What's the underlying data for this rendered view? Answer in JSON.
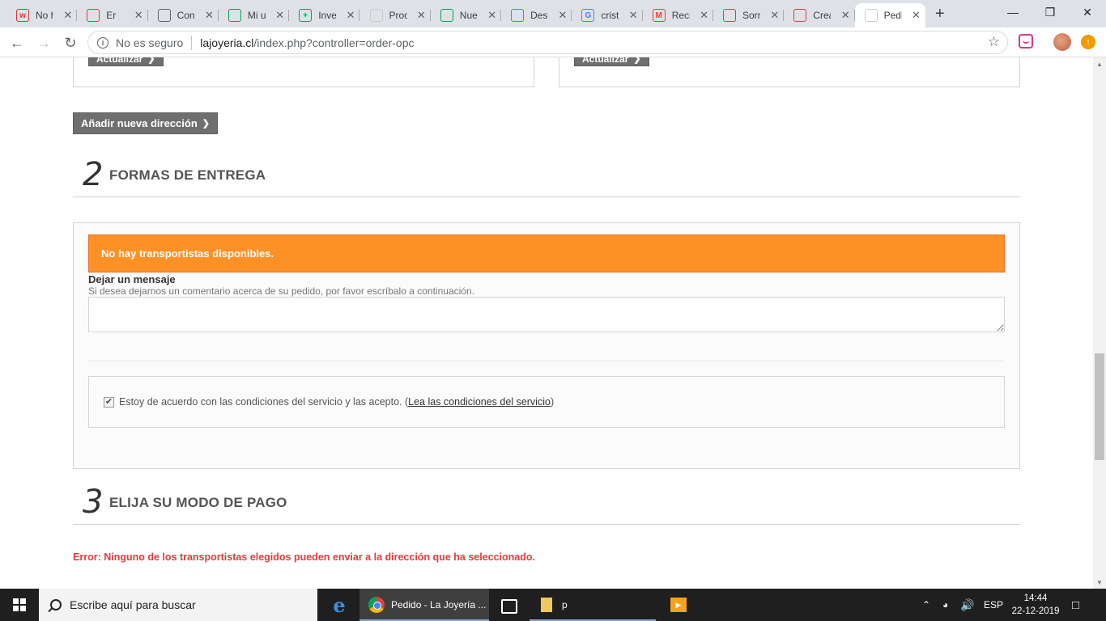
{
  "browser": {
    "tabs": [
      {
        "title": "No h",
        "icon": "wish-icon",
        "fav_text": "w",
        "fav_color": "#e3343b"
      },
      {
        "title": "Er",
        "icon": "pause-icon",
        "fav_text": "",
        "fav_color": "#c44"
      },
      {
        "title": "Cont",
        "icon": "globe-icon",
        "fav_text": "",
        "fav_color": "#5f6368"
      },
      {
        "title": "Mi u",
        "icon": "drive-icon",
        "fav_text": "",
        "fav_color": "#0f9d58"
      },
      {
        "title": "Inve",
        "icon": "sheets-icon",
        "fav_text": "+",
        "fav_color": "#0f9d58"
      },
      {
        "title": "Proc",
        "icon": "page-icon",
        "fav_text": "",
        "fav_color": "#ccc"
      },
      {
        "title": "Nue",
        "icon": "drive-icon",
        "fav_text": "",
        "fav_color": "#0f9d58"
      },
      {
        "title": "Des",
        "icon": "docs-icon",
        "fav_text": "",
        "fav_color": "#4285f4"
      },
      {
        "title": "crist",
        "icon": "google-icon",
        "fav_text": "G",
        "fav_color": "#4285f4"
      },
      {
        "title": "Reci",
        "icon": "gmail-icon",
        "fav_text": "M",
        "fav_color": "#db4437"
      },
      {
        "title": "Sorr",
        "icon": "site-icon",
        "fav_text": "",
        "fav_color": "#c44"
      },
      {
        "title": "Crea",
        "icon": "site-icon",
        "fav_text": "",
        "fav_color": "#c44"
      },
      {
        "title": "Pedi",
        "icon": "page-icon",
        "fav_text": "",
        "fav_color": "#ccc",
        "active": true
      }
    ],
    "new_tab": "+",
    "security_label": "No es seguro",
    "url_host": "lajoyeria.cl",
    "url_path": "/index.php?controller=order-opc",
    "star": "☆"
  },
  "page": {
    "update_label_left": "Actualizar",
    "update_label_right": "Actualizar",
    "add_address_label": "Añadir nueva dirección",
    "step2_num": "2",
    "step2_title": "FORMAS DE ENTREGA",
    "no_carriers": "No hay transportistas disponibles.",
    "message_label": "Dejar un mensaje",
    "message_help": "Si desea dejarnos un comentario acerca de su pedido, por favor escríbalo a continuación.",
    "terms_text": "Estoy de acuerdo con las condiciones del servicio y las acepto. (",
    "terms_link": "Lea las condiciones del servicio",
    "terms_close": ")",
    "terms_checked": true,
    "step3_num": "3",
    "step3_title": "ELIJA SU MODO DE PAGO",
    "error_text": "Error: Ninguno de los transportistas elegidos pueden enviar a la dirección que ha seleccionado.",
    "colors": {
      "alert": "#fe9126",
      "error": "#e43b3b",
      "button": "#6f6f6f"
    }
  },
  "taskbar": {
    "search_placeholder": "Escribe aquí para buscar",
    "chrome_app_label": "Pedido - La Joyería ...",
    "folder_label": "p",
    "language": "ESP",
    "time": "14:44",
    "date": "22-12-2019"
  }
}
